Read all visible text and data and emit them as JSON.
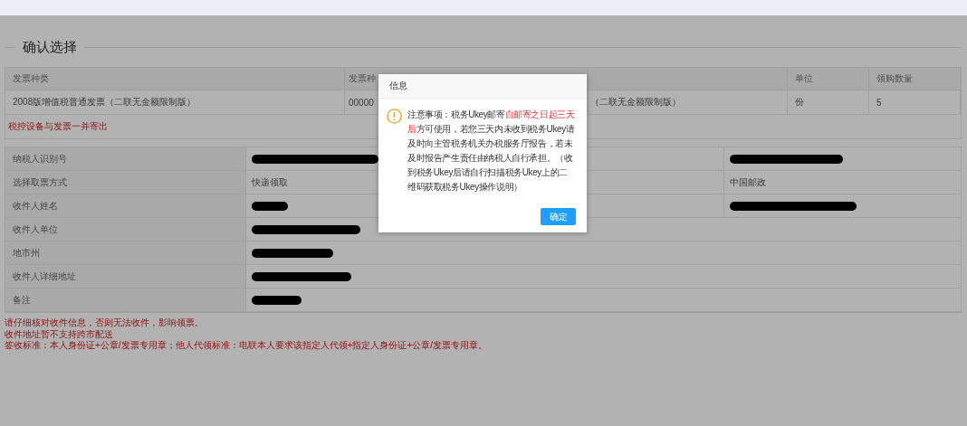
{
  "section_title": "确认选择",
  "invoice_table": {
    "columns": [
      {
        "label": "发票种类"
      },
      {
        "label": "发票种"
      },
      {},
      {
        "label": "单位"
      },
      {
        "label": "领购数量"
      }
    ],
    "rows": [
      {
        "cells": [
          "2008版增值税普通发票（二联无金额限制版）",
          "00000",
          "（二联无金额限制版）",
          "份",
          "5"
        ]
      }
    ]
  },
  "invoice_note": "税控设备与发票一并寄出",
  "form_rows": [
    {
      "label": "纳税人识别号",
      "value": {
        "kind": "redacted"
      },
      "right_value": {
        "kind": "redacted"
      }
    },
    {
      "label": "选择取票方式",
      "value": {
        "kind": "text",
        "text": "快递领取"
      },
      "right_value": {
        "kind": "text",
        "text": "中国邮政"
      }
    },
    {
      "label": "收件人姓名",
      "value": {
        "kind": "redacted"
      },
      "right_value": {
        "kind": "redacted"
      }
    },
    {
      "label": "收件人单位",
      "value": {
        "kind": "redacted"
      }
    },
    {
      "label": "地市州",
      "value": {
        "kind": "redacted"
      }
    },
    {
      "label": "收件人详细地址",
      "value": {
        "kind": "redacted"
      }
    },
    {
      "label": "备注",
      "value": {
        "kind": "redacted"
      }
    }
  ],
  "notes": [
    "请仔细核对收件信息，否则无法收件，影响领票。",
    "收件地址暂不支持跨市配送",
    "签收标准：本人身份证+公章/发票专用章；他人代领标准：电联本人要求该指定人代领+指定人身份证+公章/发票专用章。"
  ],
  "dialog": {
    "title": "信息",
    "message": [
      {
        "text": "注意事项：税务Ukey邮寄",
        "emphasis": false
      },
      {
        "text": "自邮寄之日起三天后",
        "emphasis": true
      },
      {
        "text": "方可使用，若您三天内未收到税务Ukey请及时向主管税务机关办税服务厅报告，若未及时报告产生责任由纳税人自行承担。（收到税务Ukey后请自行扫描税务Ukey上的二维码获取税务Ukey操作说明）",
        "emphasis": false
      }
    ],
    "button": "确定"
  }
}
